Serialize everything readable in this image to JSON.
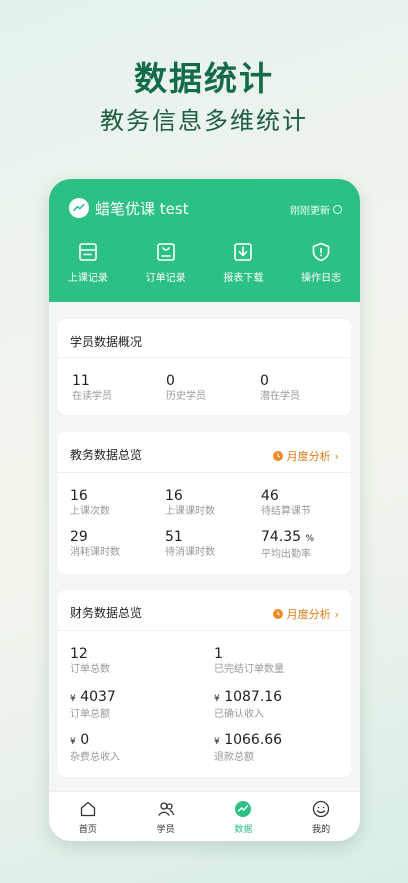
{
  "hero": {
    "title": "数据统计",
    "subtitle": "教务信息多维统计"
  },
  "header": {
    "app_name": "蜡笔优课 test",
    "refresh_label": "刚刚更新"
  },
  "quick_actions": [
    {
      "label": "上课记录",
      "icon": "class-record-icon"
    },
    {
      "label": "订单记录",
      "icon": "order-record-icon"
    },
    {
      "label": "报表下载",
      "icon": "download-icon"
    },
    {
      "label": "操作日志",
      "icon": "shield-icon"
    }
  ],
  "students": {
    "title": "学员数据概况",
    "stats": [
      {
        "value": "11",
        "label": "在读学员"
      },
      {
        "value": "0",
        "label": "历史学员"
      },
      {
        "value": "0",
        "label": "潜在学员"
      }
    ]
  },
  "academic": {
    "title": "教务数据总览",
    "link": "月度分析",
    "stats": [
      {
        "value": "16",
        "label": "上课次数"
      },
      {
        "value": "16",
        "label": "上课课时数"
      },
      {
        "value": "46",
        "label": "待结算课节"
      },
      {
        "value": "29",
        "label": "消耗课时数"
      },
      {
        "value": "51",
        "label": "待消课时数"
      },
      {
        "value": "74.35",
        "unit": "%",
        "label": "平均出勤率"
      }
    ]
  },
  "finance": {
    "title": "财务数据总览",
    "link": "月度分析",
    "stats": [
      {
        "value": "12",
        "label": "订单总数"
      },
      {
        "value": "1",
        "label": "已完结订单数量"
      },
      {
        "currency": "¥",
        "value": "4037",
        "label": "订单总额"
      },
      {
        "currency": "¥",
        "value": "1087.16",
        "label": "已确认收入"
      },
      {
        "currency": "¥",
        "value": "0",
        "label": "杂费总收入"
      },
      {
        "currency": "¥",
        "value": "1066.66",
        "label": "退款总额"
      }
    ]
  },
  "tabbar": [
    {
      "label": "首页",
      "icon": "home-icon"
    },
    {
      "label": "学员",
      "icon": "students-icon"
    },
    {
      "label": "数据",
      "icon": "data-icon",
      "active": true
    },
    {
      "label": "我的",
      "icon": "profile-icon"
    }
  ],
  "colors": {
    "primary": "#2cc084",
    "accent": "#e07a16",
    "hero": "#146b47"
  }
}
